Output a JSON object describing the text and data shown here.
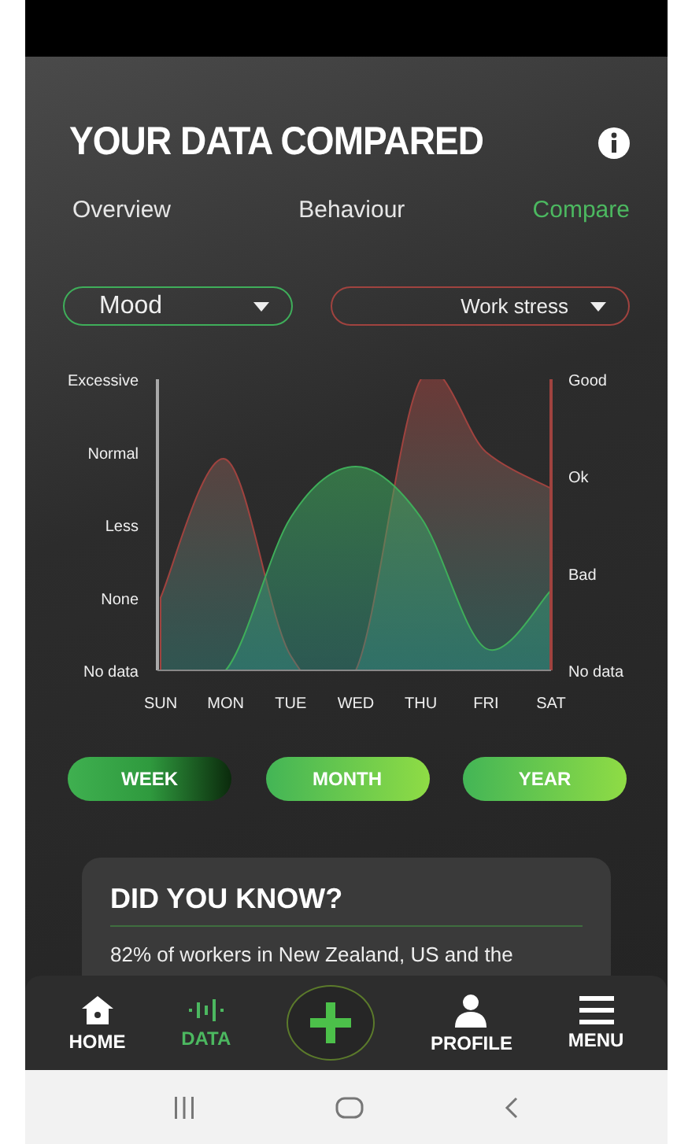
{
  "header": {
    "title": "YOUR DATA COMPARED"
  },
  "tabs": [
    {
      "label": "Overview",
      "selected": false
    },
    {
      "label": "Behaviour",
      "selected": false
    },
    {
      "label": "Compare",
      "selected": true
    }
  ],
  "selectors": [
    {
      "value": "Mood",
      "color": "#3fae5a"
    },
    {
      "value": "Work stress",
      "color": "#a0433f"
    }
  ],
  "chart": {
    "left_axis_labels": [
      "Excessive",
      "Normal",
      "Less",
      "None",
      "No data"
    ],
    "right_axis_labels": [
      "Good",
      "Ok",
      "Bad",
      "No data"
    ],
    "days": [
      "SUN",
      "MON",
      "TUE",
      "WED",
      "THU",
      "FRI",
      "SAT"
    ],
    "series": [
      {
        "color": "#a0433f"
      },
      {
        "color": "#3fae5a"
      }
    ]
  },
  "periods": [
    {
      "label": "WEEK",
      "selected": true
    },
    {
      "label": "MONTH",
      "selected": false
    },
    {
      "label": "YEAR",
      "selected": false
    }
  ],
  "card": {
    "title": "DID YOU KNOW?",
    "text": "82% of workers in New Zealand, US and the"
  },
  "nav": [
    {
      "kind": "home",
      "label": "HOME",
      "selected": false
    },
    {
      "kind": "data",
      "label": "DATA",
      "selected": true
    },
    {
      "kind": "add"
    },
    {
      "kind": "profile",
      "label": "PROFILE",
      "selected": false
    },
    {
      "kind": "menu",
      "label": "MENU",
      "selected": false
    }
  ]
}
